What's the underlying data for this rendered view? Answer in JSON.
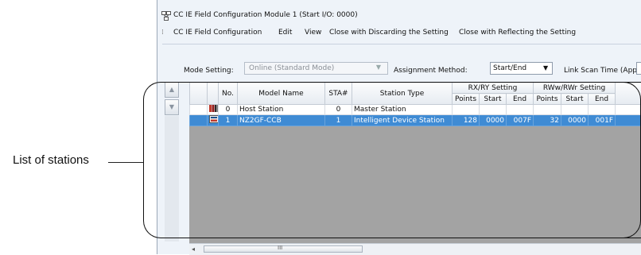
{
  "callout": {
    "label": "List of stations"
  },
  "window": {
    "title": "CC IE Field Configuration Module 1 (Start I/O: 0000)",
    "menu": [
      "CC IE Field Configuration",
      "Edit",
      "View",
      "Close with Discarding the Setting",
      "Close with Reflecting the Setting"
    ]
  },
  "settings": {
    "mode_label": "Mode Setting:",
    "mode_value": "Online (Standard Mode)",
    "assignment_label": "Assignment Method:",
    "assignment_value": "Start/End",
    "scan_label": "Link Scan Time (Approx.):"
  },
  "table": {
    "headers": {
      "no": "No.",
      "model": "Model Name",
      "sta": "STA#",
      "type": "Station Type",
      "rxry": "RX/RY Setting",
      "rwwrwr": "RWw/RWr Setting",
      "points": "Points",
      "start": "Start",
      "end": "End"
    },
    "rows": [
      {
        "icon": "master-station-icon",
        "no": "0",
        "model": "Host Station",
        "sta": "0",
        "type": "Master Station",
        "rx_points": "",
        "rx_start": "",
        "rx_end": "",
        "rw_points": "",
        "rw_start": "",
        "rw_end": "",
        "selected": false
      },
      {
        "icon": "device-station-icon",
        "no": "1",
        "model": "NZ2GF-CCB",
        "sta": "1",
        "type": "Intelligent Device Station",
        "rx_points": "128",
        "rx_start": "0000",
        "rx_end": "007F",
        "rw_points": "32",
        "rw_start": "0000",
        "rw_end": "001F",
        "selected": true
      }
    ]
  },
  "scrollbar": {
    "grip": "III"
  },
  "colors": {
    "selection": "#3f8bd4",
    "empty_area": "#a3a3a3",
    "window_bg": "#eef3f9"
  }
}
